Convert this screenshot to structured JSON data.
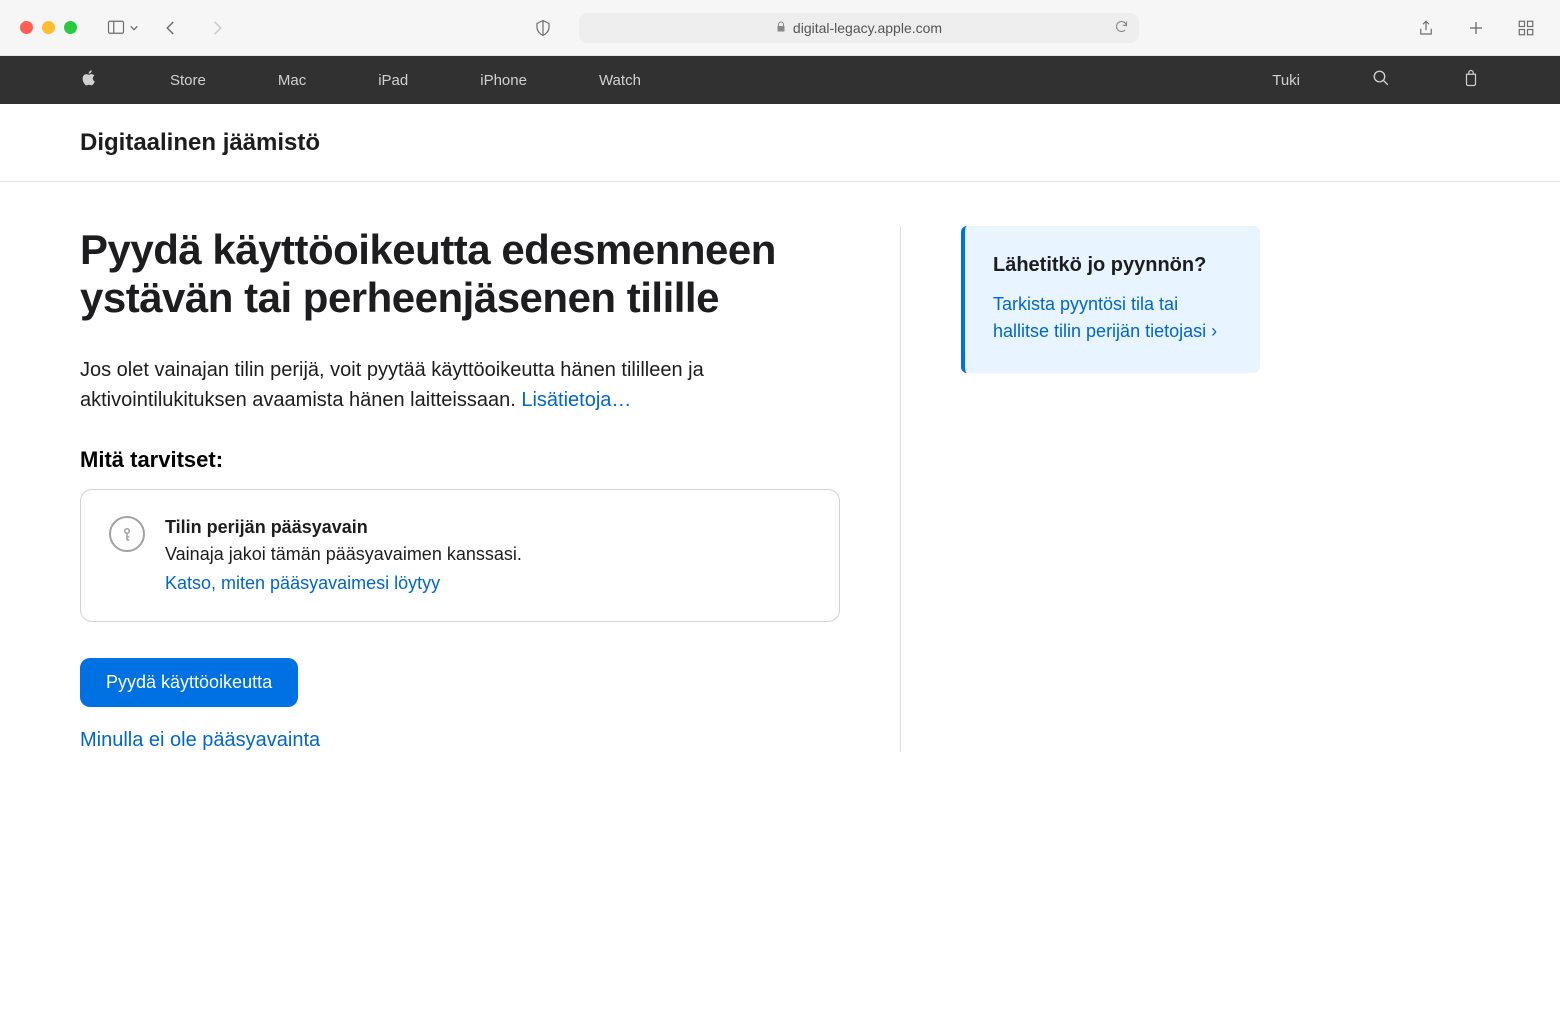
{
  "browser": {
    "url": "digital-legacy.apple.com"
  },
  "apple_nav": {
    "items": [
      "Store",
      "Mac",
      "iPad",
      "iPhone",
      "Watch"
    ],
    "right_item": "Tuki"
  },
  "subnav": {
    "title": "Digitaalinen jäämistö"
  },
  "main": {
    "heading": "Pyydä käyttöoikeutta edesmenneen ystävän tai perheenjäsenen tilille",
    "intro_text": "Jos olet vainajan tilin perijä, voit pyytää käyttöoikeutta hänen tililleen ja aktivointilukituksen avaamista hänen laitteissaan. ",
    "intro_link": "Lisätietoja…",
    "needs_title": "Mitä tarvitset:",
    "card": {
      "title": "Tilin perijän pääsyavain",
      "desc": "Vainaja jakoi tämän pääsyavaimen kanssasi.",
      "link": "Katso, miten pääsyavaimesi löytyy"
    },
    "primary_button": "Pyydä käyttöoikeutta",
    "secondary_link": "Minulla ei ole pääsyavainta"
  },
  "callout": {
    "title": "Lähetitkö jo pyynnön?",
    "link": "Tarkista pyyntösi tila tai hallitse tilin perijän tietojasi ›"
  }
}
